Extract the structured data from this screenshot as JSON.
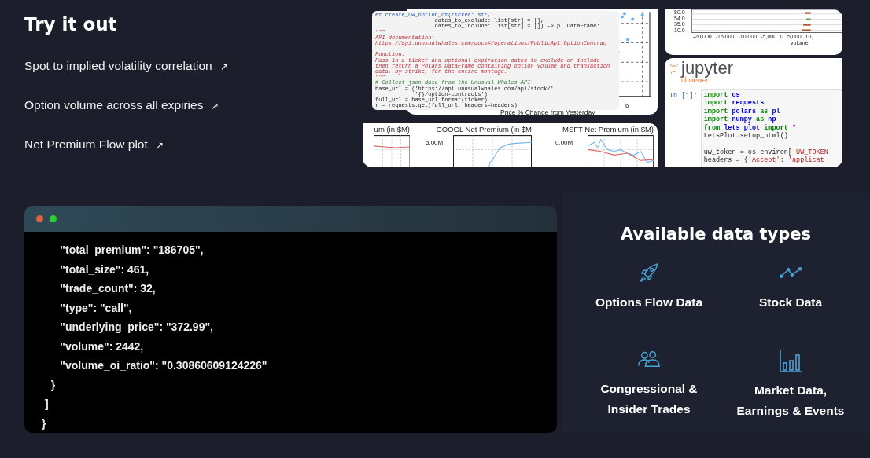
{
  "try_it_out": {
    "title": "Try it out",
    "links": [
      {
        "label": "Spot to implied volatility correlation",
        "icon": "↗"
      },
      {
        "label": "Option volume across all expiries",
        "icon": "↗"
      },
      {
        "label": "Net Premium Flow plot",
        "icon": "↗"
      }
    ]
  },
  "preview": {
    "code_lines": [
      {
        "kind": "def",
        "text": "ef create_uw_option_df(ticker: str,"
      },
      {
        "kind": "code",
        "text": "                  dates_to_exclude: list[str] = [],"
      },
      {
        "kind": "code",
        "text": "                  dates_to_include: list[str] = []) -> pl.DataFrame:"
      },
      {
        "kind": "doc",
        "text": "\"\"\""
      },
      {
        "kind": "doc",
        "text": "API documentation:"
      },
      {
        "kind": "doc",
        "text": "https://api.unusualwhales.com/docs#/operations/PublicApi.OptionContrac"
      },
      {
        "kind": "blank"
      },
      {
        "kind": "doc",
        "text": "Function:"
      },
      {
        "kind": "doc",
        "text": "Pass in a ticker and optional expiration dates to exclude or include"
      },
      {
        "kind": "doc",
        "text": "then return a Polars DataFrame containing option volume and transaction"
      },
      {
        "kind": "doc",
        "text": "data, by strike, for the entire montage."
      },
      {
        "kind": "doc",
        "text": "\"\"\""
      },
      {
        "kind": "comment",
        "text": "# Collect json data from the Unusual Whales API"
      },
      {
        "kind": "code",
        "text": "base_url = ('https://api.unusualwhales.com/api/stock/'"
      },
      {
        "kind": "code",
        "text": "            '{}/option-contracts')"
      },
      {
        "kind": "code",
        "text": "full_url = base_url.format(ticker)"
      },
      {
        "kind": "code",
        "text": "r = requests.get(full_url, headers=headers)"
      }
    ],
    "scatter_tick": "6",
    "scatter_caption": "Price % Change from Yesterday",
    "premium_charts": [
      {
        "title": "um (in $M)"
      },
      {
        "title": "GOOGL Net Premium (in $M",
        "tick": "5.00M"
      },
      {
        "title": "MSFT Net Premium (in $M)",
        "tick": "0.00M"
      }
    ],
    "histogram": {
      "yticks": [
        "80.0",
        "54.0",
        "35.0",
        "10.0"
      ],
      "xticks": [
        "-20,000",
        "-15,000",
        "-10,000",
        "-5,000",
        "0",
        "5,000",
        "10,"
      ],
      "xlabel": "volume"
    },
    "notebook": {
      "logo": "jupyter",
      "sublogo": "nbviewer",
      "prompt": "In [1]:",
      "lines": [
        {
          "tokens": [
            {
              "kind": "kw",
              "text": "import"
            },
            {
              "kind": "mod",
              "text": " os"
            }
          ]
        },
        {
          "tokens": [
            {
              "kind": "kw",
              "text": "import"
            },
            {
              "kind": "mod",
              "text": " requests"
            }
          ]
        },
        {
          "tokens": [
            {
              "kind": "kw",
              "text": "import"
            },
            {
              "kind": "mod",
              "text": " polars"
            },
            {
              "kind": "kw",
              "text": " as"
            },
            {
              "kind": "mod",
              "text": " pl"
            }
          ]
        },
        {
          "tokens": [
            {
              "kind": "kw",
              "text": "import"
            },
            {
              "kind": "mod",
              "text": " numpy"
            },
            {
              "kind": "kw",
              "text": " as"
            },
            {
              "kind": "mod",
              "text": " np"
            }
          ]
        },
        {
          "tokens": [
            {
              "kind": "kw",
              "text": "from"
            },
            {
              "kind": "mod",
              "text": " lets_plot"
            },
            {
              "kind": "kw",
              "text": " import"
            },
            {
              "kind": "op",
              "text": " *"
            }
          ]
        },
        {
          "tokens": [
            {
              "kind": "code",
              "text": "LetsPlot.setup_html()"
            }
          ]
        },
        {
          "kind": "blank"
        },
        {
          "tokens": [
            {
              "kind": "code",
              "text": "uw_token = os.environ["
            },
            {
              "kind": "str",
              "text": "'UW_TOKEN"
            }
          ]
        },
        {
          "tokens": [
            {
              "kind": "code",
              "text": "headers = {"
            },
            {
              "kind": "str",
              "text": "'Accept'"
            },
            {
              "kind": "code",
              "text": ": "
            },
            {
              "kind": "str",
              "text": "'applicat"
            }
          ]
        }
      ]
    }
  },
  "terminal": {
    "lines": [
      "      \"total_premium\": \"186705\",",
      "      \"total_size\": 461,",
      "      \"trade_count\": 32,",
      "      \"type\": \"call\",",
      "      \"underlying_price\": \"372.99\",",
      "      \"volume\": 2442,",
      "      \"volume_oi_ratio\": \"0.30860609124226\"",
      "   }",
      " ]",
      "}"
    ]
  },
  "data_types": {
    "title": "Available data types",
    "items": [
      {
        "label": "Options Flow Data"
      },
      {
        "label": "Stock Data"
      },
      {
        "label": "Congressional & Insider Trades"
      },
      {
        "label": "Market Data, Earnings & Events"
      }
    ]
  }
}
